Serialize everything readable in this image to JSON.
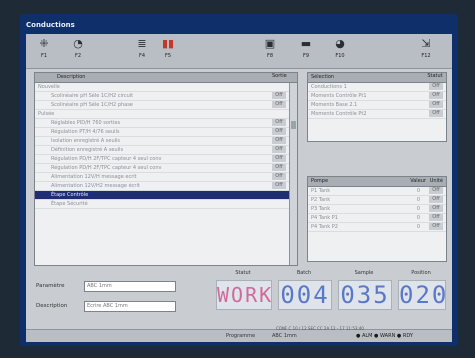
{
  "window": {
    "title": "Conductions"
  },
  "toolbar": [
    {
      "icon": "network-icon",
      "glyph": "⁜",
      "label": "F1"
    },
    {
      "icon": "clock-icon",
      "glyph": "◔",
      "label": "F2"
    },
    {
      "icon": "list-icon",
      "glyph": "≣",
      "label": "F4"
    },
    {
      "icon": "stop-icon",
      "glyph": "▮▮",
      "label": "F5"
    },
    {
      "icon": "palette-icon",
      "glyph": "▣",
      "label": "F8"
    },
    {
      "icon": "tool-icon",
      "glyph": "▬",
      "label": "F9"
    },
    {
      "icon": "camera-icon",
      "glyph": "◕",
      "label": "F10"
    },
    {
      "icon": "exit-icon",
      "glyph": "⇲",
      "label": "F12"
    }
  ],
  "main_list": {
    "header": "Description",
    "col2": "Sortie",
    "rows": [
      {
        "text": "Nouvelle",
        "val": "",
        "sel": false
      },
      {
        "text": "Scolinéaire pH Séle 1C/H2 circuit",
        "val": "Off",
        "sel": false
      },
      {
        "text": "Scolinéaire pH Séle 1C/H2 phase",
        "val": "Off",
        "sel": false
      },
      {
        "text": "Pulsée",
        "val": "",
        "sel": false
      },
      {
        "text": "Réglables PID/H 760 sorties",
        "val": "Off",
        "sel": false
      },
      {
        "text": "Régulation PT/H 4/76 seuils",
        "val": "Off",
        "sel": false
      },
      {
        "text": "Isolation enregistré A seuils",
        "val": "Off",
        "sel": false
      },
      {
        "text": "Définition enregistré A seuils",
        "val": "Off",
        "sel": false
      },
      {
        "text": "Régulation PD/H 2F/TPC capteur 4 seul conv",
        "val": "Off",
        "sel": false
      },
      {
        "text": "Régulation PD/H 2F/TPC capteur 4 seul conv",
        "val": "Off",
        "sel": false
      },
      {
        "text": "Alimentation 12V/H message ecrit",
        "val": "Off",
        "sel": false
      },
      {
        "text": "Alimentation 12V/H2 message écrit",
        "val": "Off",
        "sel": false
      },
      {
        "text": "Étape Contrôle",
        "val": "",
        "sel": true
      },
      {
        "text": "Étape Sécurité",
        "val": "",
        "sel": false
      }
    ]
  },
  "right_top": {
    "header": "Sélection",
    "col2": "Statut",
    "rows": [
      {
        "text": "Conductions 1",
        "val": "Off"
      },
      {
        "text": "Moments Contrôle Pt1",
        "val": "Off"
      },
      {
        "text": "Moments Base 2.1",
        "val": "Off"
      },
      {
        "text": "Moments Contrôle Pt2",
        "val": "Off"
      }
    ]
  },
  "right_bottom": {
    "header": "Pompe",
    "col2": "Valeur",
    "col3": "Unité",
    "rows": [
      {
        "text": "P1 Tank",
        "v": "0",
        "u": "Off"
      },
      {
        "text": "P2 Tank",
        "v": "0",
        "u": "Off"
      },
      {
        "text": "P3 Tank",
        "v": "0",
        "u": "Off"
      },
      {
        "text": "P4 Tank P1",
        "v": "0",
        "u": "Off"
      },
      {
        "text": "P4 Tank P2",
        "v": "0",
        "u": "Off"
      }
    ]
  },
  "form": {
    "label1": "Paramètre",
    "value1": "ABC 1mm",
    "label2": "Description",
    "value2": "Ecrire ABC 1mm"
  },
  "displays": [
    {
      "label": "Statut",
      "value": "WORK",
      "color": "#d06a9c"
    },
    {
      "label": "Batch",
      "value": "004",
      "color": "#5a78c8"
    },
    {
      "label": "Sample",
      "value": "035",
      "color": "#5a78c8"
    },
    {
      "label": "Position",
      "value": "020",
      "color": "#5a78c8"
    }
  ],
  "status": {
    "left": "CONF C 10 / 12 SEC CC 2A 12 - 17 11:53:40",
    "program_label": "Programme",
    "program_value": "ABC 1mm",
    "indicators": "● ALM ● WARN ● RDY"
  }
}
